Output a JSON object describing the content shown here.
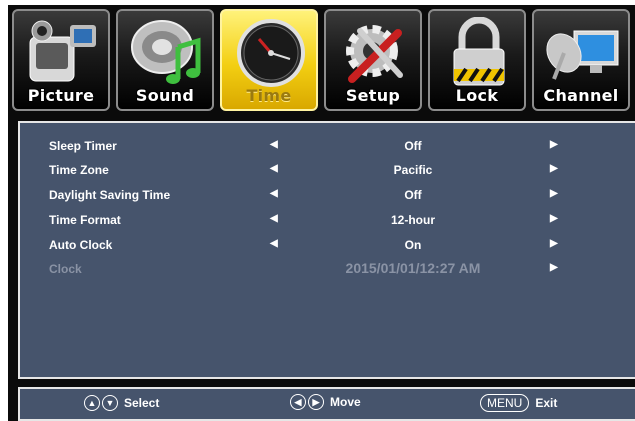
{
  "tabs": [
    {
      "label": "Picture",
      "icon": "camcorder-icon",
      "active": false
    },
    {
      "label": "Sound",
      "icon": "speaker-music-note-icon",
      "active": false
    },
    {
      "label": "Time",
      "icon": "clock-icon",
      "active": true
    },
    {
      "label": "Setup",
      "icon": "gear-tools-icon",
      "active": false
    },
    {
      "label": "Lock",
      "icon": "padlock-icon",
      "active": false
    },
    {
      "label": "Channel",
      "icon": "satellite-monitor-icon",
      "active": false
    }
  ],
  "settings": [
    {
      "label": "Sleep Timer",
      "value": "Off",
      "left_arrow": "◀",
      "right_arrow": "▶"
    },
    {
      "label": "Time Zone",
      "value": "Pacific",
      "left_arrow": "◀",
      "right_arrow": "▶"
    },
    {
      "label": "Daylight Saving Time",
      "value": "Off",
      "left_arrow": "◀",
      "right_arrow": "▶"
    },
    {
      "label": "Time Format",
      "value": "12-hour",
      "left_arrow": "◀",
      "right_arrow": "▶"
    },
    {
      "label": "Auto Clock",
      "value": "On",
      "left_arrow": "◀",
      "right_arrow": "▶"
    },
    {
      "label": "Clock",
      "value": "2015/01/01/12:27 AM",
      "left_arrow": "",
      "right_arrow": "▶",
      "disabled": true
    }
  ],
  "footer": {
    "select": {
      "up": "▲",
      "down": "▼",
      "label": "Select"
    },
    "move": {
      "left": "◀",
      "right": "▶",
      "label": "Move"
    },
    "exit": {
      "key": "MENU",
      "label": "Exit"
    }
  },
  "colors": {
    "panel": "#46546c",
    "active_tab": "#f3cf12",
    "disabled_text": "#8a93a5"
  }
}
